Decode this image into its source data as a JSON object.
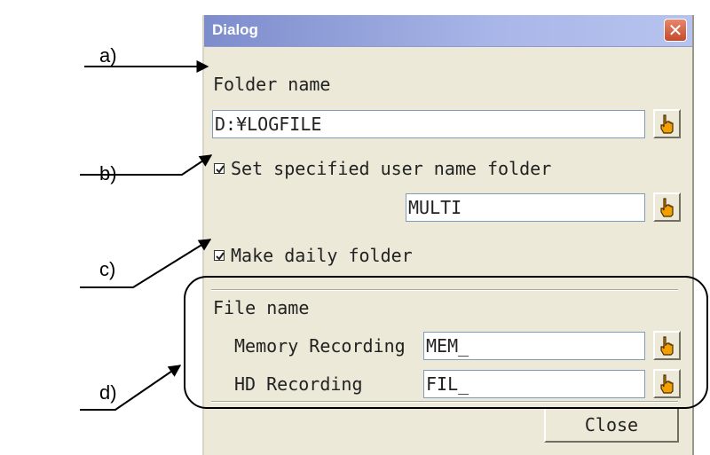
{
  "annotations": {
    "a": "a)",
    "b": "b)",
    "c": "c)",
    "d": "d)"
  },
  "dialog": {
    "title": "Dialog",
    "close_x": "✕",
    "folder_name_label": "Folder name",
    "folder_name_value": "D:¥LOGFILE",
    "user_folder_label": "Set specified user name folder",
    "user_folder_checked": true,
    "user_folder_value": "MULTI",
    "daily_folder_label": "Make daily folder",
    "daily_folder_checked": true,
    "file_name_label": "File name",
    "memory_label": "Memory Recording",
    "memory_value": "MEM_",
    "hd_label": "HD Recording",
    "hd_value": "FIL_",
    "close_button": "Close"
  },
  "colors": {
    "title_bar": "#a9b6e8",
    "dialog_bg": "#ece9d8",
    "close_x": "#d35a3c",
    "hand_icon": "#f2a000"
  }
}
